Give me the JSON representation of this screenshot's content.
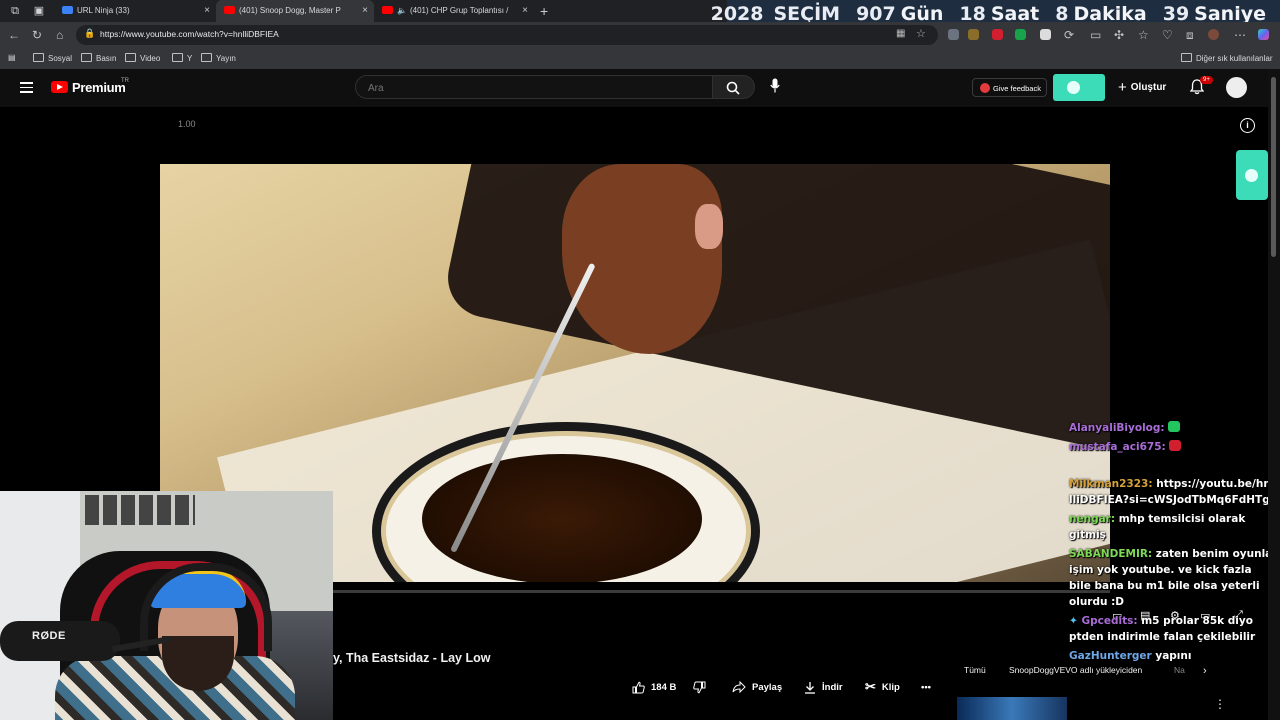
{
  "browser": {
    "tabs": [
      {
        "label": "URL Ninja (33)",
        "active": false,
        "favicon_color": "#3b82f6"
      },
      {
        "label": "(401) Snoop Dogg, Master P",
        "active": true,
        "favicon_color": "#ff0000"
      },
      {
        "label": "(401) CHP Grup Toplantısı / ",
        "active": false,
        "favicon_color": "#ff0000"
      }
    ],
    "close_glyph": "×",
    "new_tab_glyph": "+",
    "url": "https://www.youtube.com/watch?v=hnlliDBFIEA",
    "bookmarks": [
      "Sosyal",
      "Basın",
      "Video",
      "Y",
      "Yayın"
    ],
    "bookmarks_other": "Diğer sık kullanılanlar"
  },
  "overlay_counter": {
    "year": "2028",
    "event": "SEÇİM",
    "days_value": "907",
    "days_label": "Gün",
    "hours_value": "18",
    "hours_label": "Saat",
    "minutes_value": "8",
    "minutes_label": "Dakika",
    "seconds_value": "39",
    "seconds_label": "Saniye"
  },
  "youtube": {
    "logo_text": "Premium",
    "logo_country": "TR",
    "search_placeholder": "Ara",
    "feedback_label": "Give feedback",
    "create_label": "Oluştur",
    "notification_badge": "9+",
    "speed_label": "1.00",
    "video_title": "y, Tha Eastsidaz - Lay Low",
    "like_count": "184 B",
    "share_label": "Paylaş",
    "download_label": "İndir",
    "clip_label": "Klip",
    "more_label": "•••",
    "chips": [
      "Tümü",
      "SnoopDoggVEVO adlı yükleyiciden",
      "Na"
    ]
  },
  "chat": [
    {
      "user": "AlanyaliBiyolog:",
      "text": "",
      "color": "purple",
      "emote_color": "#22c55e"
    },
    {
      "user": "mustafa_aci675:",
      "text": "",
      "color": "purple",
      "emote_color": "#d11f2f"
    },
    {
      "user": "Milkman2323:",
      "text": "https://youtu.be/hnlliDBFIEA?si=cWSJodTbMq6FdHTg",
      "color": "gold"
    },
    {
      "user": "nengar:",
      "text": "mhp temsilcisi olarak gitmiş",
      "color": "green"
    },
    {
      "user": "SABANDEMIR:",
      "text": "zaten benim oyunla işim yok youtube. ve kick fazla bile bana bu m1 bile olsa yeterli olurdu :D",
      "color": "green"
    },
    {
      "user": "Gpcedits:",
      "text": "m5 prolar 85k diyo ptden indirimle falan çekilebilir",
      "color": "purple"
    },
    {
      "user": "GazHunterger",
      "text": "yapını",
      "color": "blue"
    }
  ],
  "webcam": {
    "mic_brand": "RØDE"
  }
}
